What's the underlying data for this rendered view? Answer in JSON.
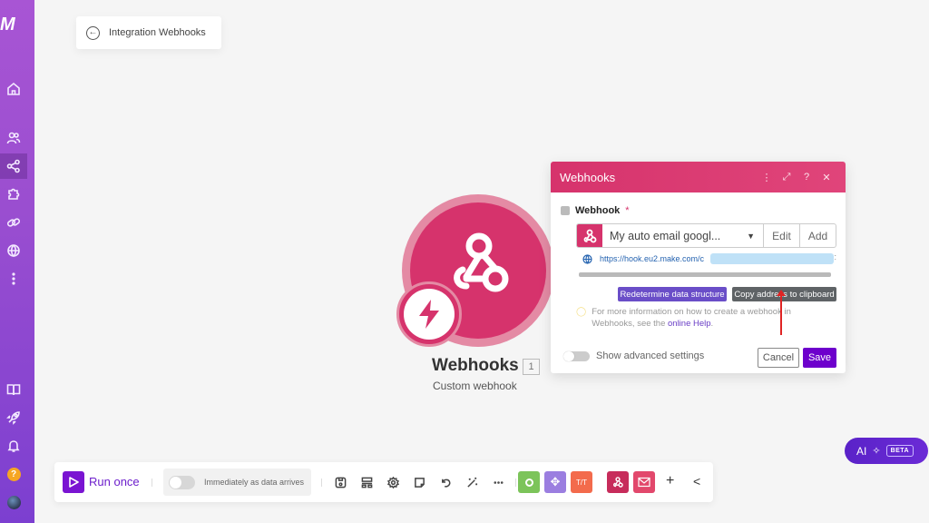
{
  "sidebar": {
    "logo": "M",
    "items": [
      {
        "name": "home",
        "icon": "home-icon"
      },
      {
        "name": "team",
        "icon": "users-icon"
      },
      {
        "name": "scenarios",
        "icon": "share-icon",
        "active": true
      },
      {
        "name": "apps",
        "icon": "puzzle-icon"
      },
      {
        "name": "connections",
        "icon": "link-icon"
      },
      {
        "name": "webhooks",
        "icon": "globe-icon"
      },
      {
        "name": "more",
        "icon": "more-vertical-icon"
      }
    ],
    "bottom_items": [
      {
        "name": "docs",
        "icon": "book-icon"
      },
      {
        "name": "whats-new",
        "icon": "rocket-icon"
      },
      {
        "name": "notifications",
        "icon": "bell-icon"
      },
      {
        "name": "help",
        "icon": "help-icon",
        "label": "?"
      },
      {
        "name": "profile",
        "icon": "avatar-icon"
      }
    ]
  },
  "breadcrumb": {
    "back_label": "Integration Webhooks"
  },
  "module": {
    "title": "Webhooks",
    "count": "1",
    "subtitle": "Custom webhook",
    "color": "#d6336c"
  },
  "dialog": {
    "title": "Webhooks",
    "header_icons": [
      "more-vertical-icon",
      "expand-icon",
      "help-icon",
      "close-icon"
    ],
    "field_label": "Webhook",
    "required_mark": "*",
    "selected_webhook": "My auto email googl...",
    "edit_label": "Edit",
    "add_label": "Add",
    "url": "https://hook.eu2.make.com/c",
    "redetermine_label": "Redetermine data structure",
    "copy_label": "Copy address to clipboard",
    "help_text": "For more information on how to create a webhook in Webhooks, see the",
    "help_link": "online Help",
    "help_end": ".",
    "advanced_label": "Show advanced settings",
    "cancel_label": "Cancel",
    "save_label": "Save"
  },
  "toolbar": {
    "run_label": "Run once",
    "schedule_label": "Immediately as data arrives",
    "icons": [
      "save-icon",
      "auto-align-icon",
      "settings-icon",
      "notes-icon",
      "undo-icon",
      "magic-wand-icon",
      "more-horizontal-icon"
    ],
    "tools": [
      {
        "name": "tools",
        "color": "#7cc45a"
      },
      {
        "name": "flow-control",
        "color": "#9b7ee0"
      },
      {
        "name": "text-parser",
        "color": "#f36b4c",
        "label": "T/T"
      },
      {
        "name": "webhooks",
        "color": "#c72c5b"
      },
      {
        "name": "email",
        "color": "#e2486c"
      }
    ],
    "add_label": "+",
    "collapse_label": "<"
  },
  "ai_button": {
    "label": "AI",
    "badge": "BETA"
  }
}
